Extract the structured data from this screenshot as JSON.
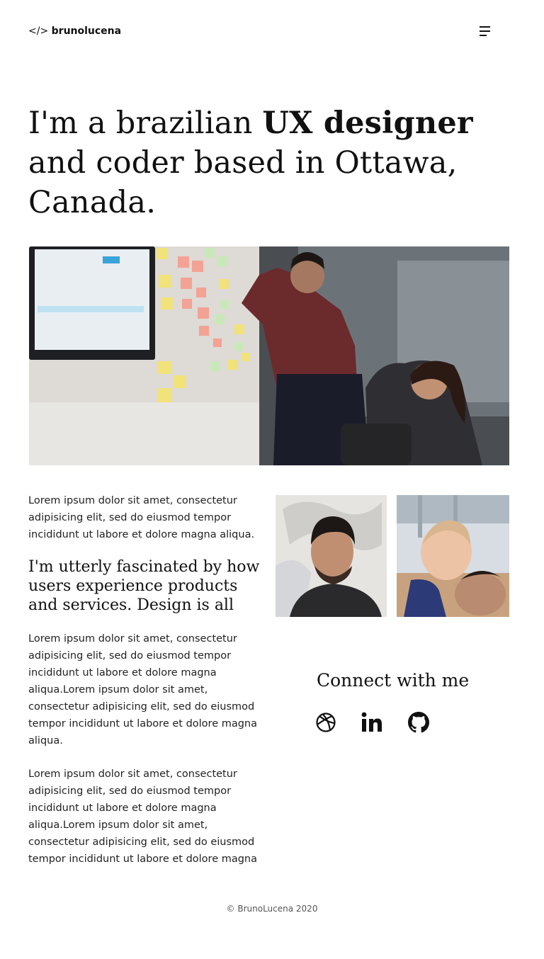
{
  "header": {
    "logo_code": "</>",
    "logo_name": "brunolucena"
  },
  "hero": {
    "part1": "I'm a brazilian ",
    "bold": "UX designer",
    "part2": " and coder  based in Ottawa, Canada."
  },
  "content": {
    "intro": "Lorem ipsum dolor sit amet, consectetur adipisicing elit, sed do eiusmod tempor incididunt ut labore et dolore magna aliqua.",
    "quote": "I'm utterly fascinated by how users experience products and services. Design is all",
    "para2": "Lorem ipsum dolor sit amet, consectetur adipisicing elit, sed do eiusmod tempor incididunt ut labore et dolore magna aliqua.Lorem ipsum dolor sit amet, consectetur adipisicing elit, sed do eiusmod tempor incididunt ut labore et dolore magna aliqua.",
    "para3": "Lorem ipsum dolor sit amet, consectetur adipisicing elit, sed do eiusmod tempor incididunt ut labore et dolore magna aliqua.Lorem ipsum dolor sit amet, consectetur adipisicing elit, sed do eiusmod tempor incididunt ut labore et dolore magna"
  },
  "connect": {
    "title": "Connect with me",
    "icons": [
      "dribbble-icon",
      "linkedin-icon",
      "github-icon"
    ]
  },
  "footer": {
    "copyright": "© BrunoLucena 2020"
  },
  "colors": {
    "text": "#111111",
    "background": "#ffffff",
    "muted": "#555555"
  }
}
